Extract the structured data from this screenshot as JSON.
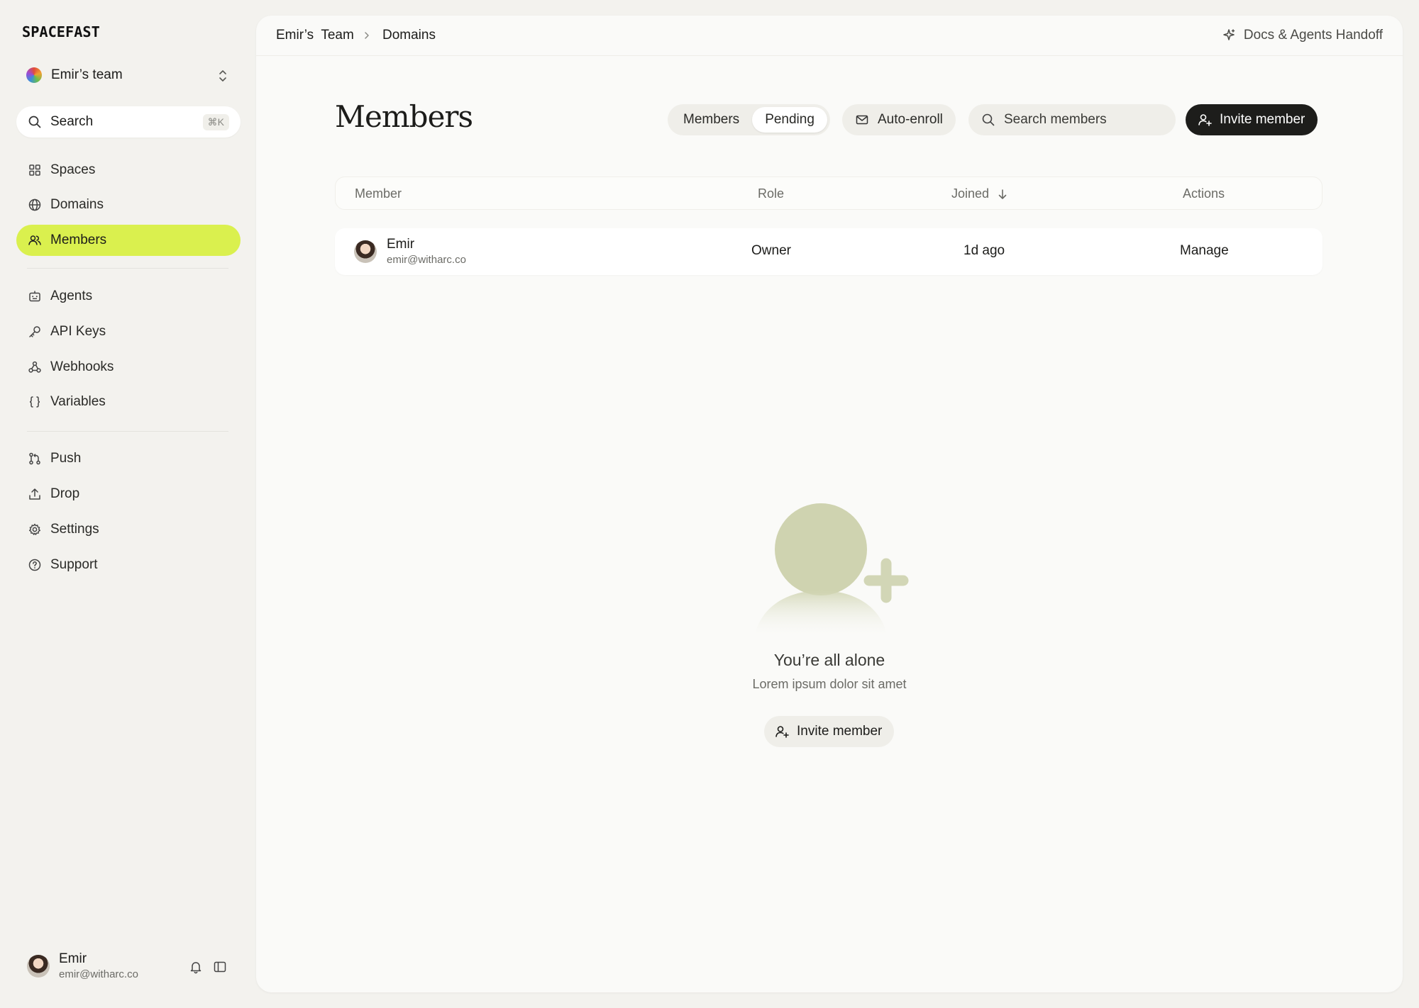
{
  "app": {
    "logo_text": "SPACEFAST"
  },
  "sidebar": {
    "team_name": "Emir’s team",
    "search": {
      "label": "Search",
      "shortcut": "⌘K"
    },
    "nav_groups": [
      [
        {
          "label": "Spaces",
          "icon": "grid-icon"
        },
        {
          "label": "Domains",
          "icon": "globe-icon"
        },
        {
          "label": "Members",
          "icon": "users-icon",
          "active": true
        }
      ],
      [
        {
          "label": "Agents",
          "icon": "robot-icon"
        },
        {
          "label": "API Keys",
          "icon": "key-icon"
        },
        {
          "label": "Webhooks",
          "icon": "webhook-icon"
        },
        {
          "label": "Variables",
          "icon": "braces-icon"
        }
      ],
      [
        {
          "label": "Push",
          "icon": "git-branch-icon"
        },
        {
          "label": "Drop",
          "icon": "upload-icon"
        },
        {
          "label": "Settings",
          "icon": "gear-icon"
        },
        {
          "label": "Support",
          "icon": "help-circle-icon"
        }
      ]
    ],
    "user": {
      "name": "Emir",
      "email": "emir@witharc.co"
    }
  },
  "topbar": {
    "breadcrumb": [
      "Emir’s  Team",
      "Domains"
    ],
    "docs_link": "Docs & Agents Handoff"
  },
  "page": {
    "title": "Members",
    "tabs": [
      {
        "label": "Members",
        "selected": false
      },
      {
        "label": "Pending",
        "selected": true
      }
    ],
    "auto_enroll_label": "Auto-enroll",
    "search_placeholder": "Search members",
    "invite_label": "Invite member"
  },
  "table": {
    "columns": [
      "Member",
      "Role",
      "Joined",
      "Actions"
    ],
    "sort_column": "Joined",
    "rows": [
      {
        "name": "Emir",
        "email": "emir@witharc.co",
        "role": "Owner",
        "joined": "1d ago",
        "action": "Manage"
      }
    ]
  },
  "empty_state": {
    "title": "You’re all alone",
    "subtitle": "Lorem ipsum dolor sit amet",
    "button_label": "Invite member"
  },
  "colors": {
    "accent": "#daf04e",
    "primary_button": "#1d1d1b",
    "background": "#f3f2ee",
    "panel": "#fafaf8",
    "illustration": "#cfd3b0"
  }
}
